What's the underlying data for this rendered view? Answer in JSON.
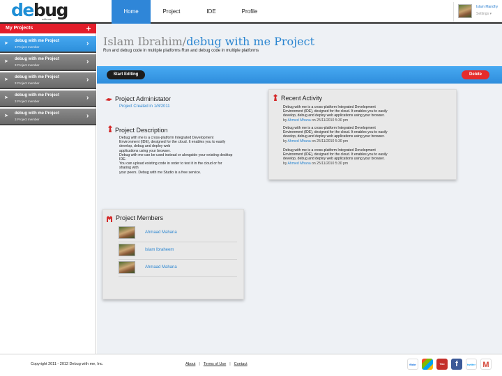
{
  "brand": {
    "logo_de": "de",
    "logo_bug": "bug",
    "logo_tag": "with me"
  },
  "nav": [
    {
      "label": "Home",
      "active": true
    },
    {
      "label": "Project",
      "active": false
    },
    {
      "label": "IDE",
      "active": false
    },
    {
      "label": "Profile",
      "active": false
    }
  ],
  "user": {
    "name": "Islam Mandhy",
    "settings": "Settings"
  },
  "sidebar": {
    "title": "My Projects",
    "add_icon": "plus-icon",
    "items": [
      {
        "name": "debug with me Project",
        "members": "3 Project member",
        "active": true
      },
      {
        "name": "debug with me Project",
        "members": "3 Project member",
        "active": false
      },
      {
        "name": "debug with me Project",
        "members": "3 Project member",
        "active": false
      },
      {
        "name": "debug with me Project",
        "members": "3 Project member",
        "active": false
      },
      {
        "name": "debug with me Project",
        "members": "3 Project member",
        "active": false
      }
    ]
  },
  "project": {
    "owner": "Islam Ibrahim",
    "separator": "/",
    "name": "debug with me Project",
    "subtitle": "Run and debug code in multiple platforms Run and debug code in multiple platforms",
    "edit_label": "Start Editing",
    "delete_label": "Delete"
  },
  "admin": {
    "title": "Project Administator",
    "created": "Project Created in 1/8/2011"
  },
  "description": {
    "title": "Project Description",
    "lines": [
      "Debug with me is a cross-platform Integrated Development",
      "Environment (IDE), designed for the cloud. It enables you to easily",
      "develop, debug and deploy web",
      "applications using your browser.",
      "Debug with me can be used instead or alongside your existing desktop",
      "IDE.",
      " You can upload existing code in order to test it in the cloud or for",
      "sharing with",
      "your peers. Debug with me Studio is a free service."
    ]
  },
  "members": {
    "title": "Project Members",
    "list": [
      "Ahmaad Mahana",
      "Islam Ibraheem",
      "Ahmaad Mahana"
    ]
  },
  "activity": {
    "title": "Recent Activity",
    "items": [
      {
        "l1": "Debug with me is a cross-platform Integrated Development",
        "l2": "Environment (IDE), designed for the cloud. It enables you to easily",
        "l3": "develop, debug and deploy web applications using your browser.",
        "by_prefix": "by",
        "author": "Ahmed Mhana",
        "when": "on 25/11/2010 5:30 pm"
      },
      {
        "l1": "Debug with me is a cross-platform Integrated Development",
        "l2": "Environment (IDE), designed for the cloud. It enables you to easily",
        "l3": "develop, debug and deploy web applications using your browser.",
        "by_prefix": "by",
        "author": "Ahmed Mhana",
        "when": "on 25/11/2010 5:30 pm"
      },
      {
        "l1": "Debug with me is a cross-platform Integrated Development",
        "l2": "Environment (IDE), designed for the cloud. It enables you to easily",
        "l3": "develop, debug and deploy web applications using your browser.",
        "by_prefix": "by",
        "author": "Ahmed Mhana",
        "when": "on 25/11/2010 5:30 pm"
      }
    ]
  },
  "footer": {
    "copyright": "Copyright 2011 - 2012 Debug with me, Inc.",
    "links": [
      "About",
      "Terms of Use",
      "Contact"
    ],
    "link_separator": "|",
    "social": [
      {
        "name": "flickr-icon",
        "label": "flickr",
        "color": "#ffffff"
      },
      {
        "name": "windows-icon",
        "label": "",
        "color": "#f2b01e"
      },
      {
        "name": "youtube-icon",
        "label": "You Tube",
        "color": "#c4302b"
      },
      {
        "name": "facebook-icon",
        "label": "f",
        "color": "#3b5998"
      },
      {
        "name": "twitter-icon",
        "label": "twitter",
        "color": "#ffffff"
      },
      {
        "name": "gmail-icon",
        "label": "M",
        "color": "#ffffff"
      }
    ]
  },
  "colors": {
    "accent_blue": "#2f86d8",
    "accent_red": "#e31d2a",
    "sidebar_grey": "#7a7a7a"
  }
}
